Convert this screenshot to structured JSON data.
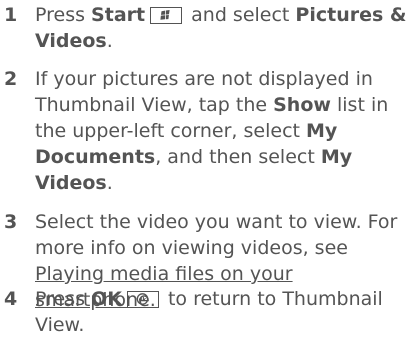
{
  "steps": [
    {
      "number": "1",
      "press": "Press ",
      "start": "Start",
      "and_select": " and select ",
      "pictures_videos": "Pictures & Videos",
      "period": "."
    },
    {
      "number": "2",
      "text_a": "If your pictures are not displayed in Thumbnail View, tap the ",
      "show": "Show",
      "text_b": " list in the upper-left corner, select ",
      "my_documents": "My Documents",
      "text_c": ", and then select ",
      "my_videos": "My Videos",
      "period": "."
    },
    {
      "number": "3",
      "text_a": "Select the video you want to view. For more info on viewing videos, see ",
      "link": "Playing media files on your smartphone",
      "period": "."
    },
    {
      "number": "4",
      "press": "Press ",
      "ok": "OK",
      "text_b": " to return to Thumbnail View."
    }
  ],
  "icons": {
    "start_key": "windows-start-key-icon",
    "ok_key": "ok-key-icon"
  }
}
